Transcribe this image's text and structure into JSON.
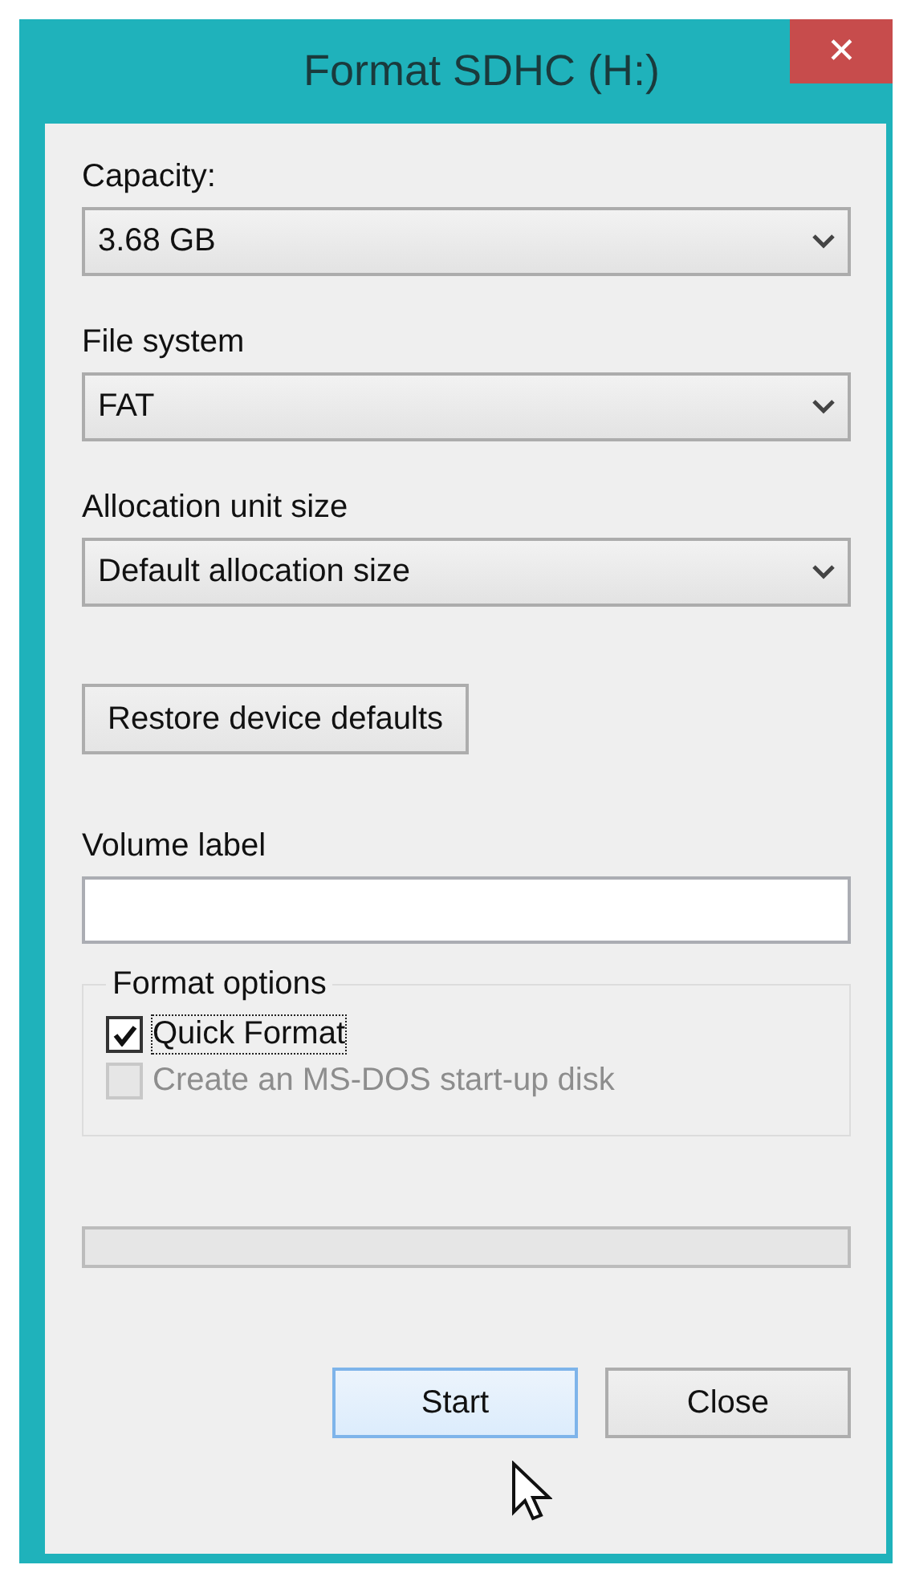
{
  "window": {
    "title": "Format SDHC (H:)",
    "close_glyph": "✕"
  },
  "fields": [
    {
      "kind": "dropdown",
      "label": "Capacity:",
      "value": "3.68 GB"
    },
    {
      "kind": "dropdown",
      "label": "File system",
      "value": "FAT"
    },
    {
      "kind": "dropdown",
      "label": "Allocation unit size",
      "value": "Default allocation size"
    },
    {
      "kind": "button",
      "label": "Restore device defaults"
    },
    {
      "kind": "textbox",
      "label": "Volume label"
    }
  ],
  "format_options": {
    "title": "Format options",
    "options": [
      {
        "label": "Quick Format",
        "checked": true,
        "disabled": false,
        "focused": true
      },
      {
        "label": "Create an MS-DOS start-up disk",
        "checked": false,
        "disabled": true,
        "focused": false
      }
    ]
  },
  "buttons": [
    {
      "label": "Start",
      "hovered": true
    },
    {
      "label": "Close",
      "hovered": false
    }
  ]
}
